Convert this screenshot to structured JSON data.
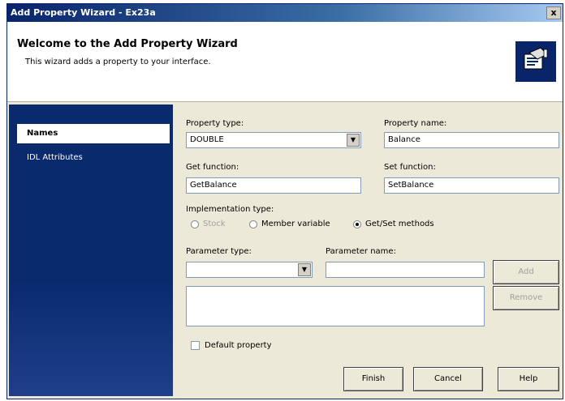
{
  "window": {
    "title": "Add Property Wizard - Ex23a",
    "close_glyph": "x"
  },
  "header": {
    "title": "Welcome to the Add Property Wizard",
    "subtitle": "This wizard adds a property to your interface.",
    "logo_icon": "wizard-properties-icon"
  },
  "sidebar": {
    "items": [
      {
        "label": "Names",
        "active": true
      },
      {
        "label": "IDL Attributes",
        "active": false
      }
    ]
  },
  "form": {
    "property_type": {
      "label": "Property type:",
      "value": "DOUBLE"
    },
    "property_name": {
      "label": "Property name:",
      "value": "Balance"
    },
    "get_function": {
      "label": "Get function:",
      "value": "GetBalance"
    },
    "set_function": {
      "label": "Set function:",
      "value": "SetBalance"
    },
    "implementation": {
      "label": "Implementation type:",
      "options": [
        {
          "label": "Stock",
          "selected": false,
          "enabled": false
        },
        {
          "label": "Member variable",
          "selected": false,
          "enabled": true
        },
        {
          "label": "Get/Set methods",
          "selected": true,
          "enabled": true
        }
      ]
    },
    "parameter_type": {
      "label": "Parameter type:",
      "value": ""
    },
    "parameter_name": {
      "label": "Parameter name:",
      "value": ""
    },
    "add_label": "Add",
    "remove_label": "Remove",
    "default_property": {
      "label": "Default property",
      "checked": false
    }
  },
  "footer": {
    "finish": "Finish",
    "cancel": "Cancel",
    "help": "Help"
  },
  "colors": {
    "sidebar": "#0a2a6e",
    "titlebar": "#0a246a",
    "face": "#ece9d8"
  }
}
